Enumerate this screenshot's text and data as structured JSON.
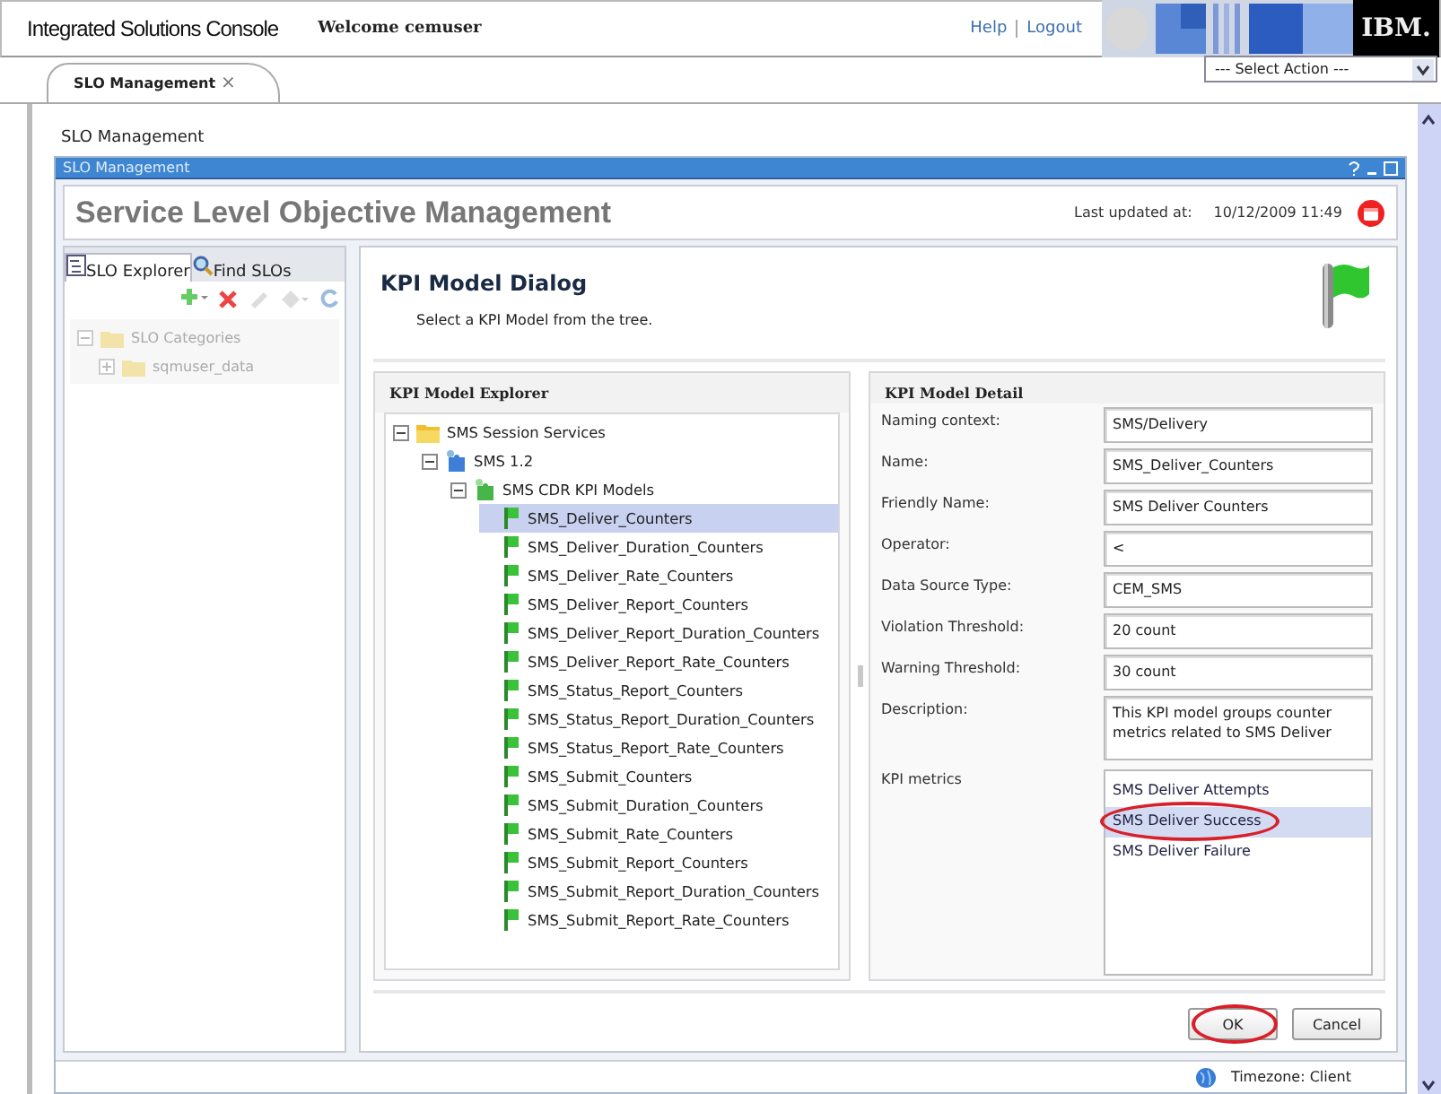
{
  "header": {
    "title": "Integrated Solutions Console",
    "welcome": "Welcome cemuser",
    "links": [
      "Help",
      "Logout"
    ],
    "logo": "IBM."
  },
  "tabs": [
    {
      "label": "SLO Management",
      "close": "×",
      "selected": true
    }
  ],
  "action_select": {
    "value": "--- Select Action ---"
  },
  "breadcrumb": "SLO Management",
  "portlet": {
    "title": "SLO Management"
  },
  "page": {
    "title": "Service Level Objective Management",
    "updated_label": "Last updated at:",
    "updated_value": "10/12/2009 11:49"
  },
  "slo_explorer": {
    "tabs": [
      {
        "label": "SLO Explorer",
        "selected": true
      },
      {
        "label": "Find SLOs",
        "selected": false
      }
    ],
    "disabled": true,
    "tree": [
      {
        "label": "SLO Categories",
        "expanded": true,
        "children": [
          {
            "label": "sqmuser_data",
            "expanded": false
          }
        ]
      }
    ]
  },
  "dialog": {
    "title": "KPI Model Dialog",
    "subtitle": "Select a KPI Model from the tree.",
    "explorer_title": "KPI Model Explorer",
    "tree": [
      {
        "label": "SMS Session Services",
        "kind": "folder",
        "expanded": true,
        "selected": false,
        "children": [
          {
            "label": "SMS 1.2",
            "kind": "service",
            "expanded": true,
            "selected": false,
            "children": [
              {
                "label": "SMS CDR KPI Models",
                "kind": "models",
                "expanded": true,
                "selected": false,
                "children": [
                  {
                    "label": "SMS_Deliver_Counters",
                    "kind": "model",
                    "selected": true
                  },
                  {
                    "label": "SMS_Deliver_Duration_Counters",
                    "kind": "model",
                    "selected": false
                  },
                  {
                    "label": "SMS_Deliver_Rate_Counters",
                    "kind": "model",
                    "selected": false
                  },
                  {
                    "label": "SMS_Deliver_Report_Counters",
                    "kind": "model",
                    "selected": false
                  },
                  {
                    "label": "SMS_Deliver_Report_Duration_Counters",
                    "kind": "model",
                    "selected": false
                  },
                  {
                    "label": "SMS_Deliver_Report_Rate_Counters",
                    "kind": "model",
                    "selected": false
                  },
                  {
                    "label": "SMS_Status_Report_Counters",
                    "kind": "model",
                    "selected": false
                  },
                  {
                    "label": "SMS_Status_Report_Duration_Counters",
                    "kind": "model",
                    "selected": false
                  },
                  {
                    "label": "SMS_Status_Report_Rate_Counters",
                    "kind": "model",
                    "selected": false
                  },
                  {
                    "label": "SMS_Submit_Counters",
                    "kind": "model",
                    "selected": false
                  },
                  {
                    "label": "SMS_Submit_Duration_Counters",
                    "kind": "model",
                    "selected": false
                  },
                  {
                    "label": "SMS_Submit_Rate_Counters",
                    "kind": "model",
                    "selected": false
                  },
                  {
                    "label": "SMS_Submit_Report_Counters",
                    "kind": "model",
                    "selected": false
                  },
                  {
                    "label": "SMS_Submit_Report_Duration_Counters",
                    "kind": "model",
                    "selected": false
                  },
                  {
                    "label": "SMS_Submit_Report_Rate_Counters",
                    "kind": "model",
                    "selected": false
                  }
                ]
              }
            ]
          }
        ]
      }
    ],
    "detail_title": "KPI Model Detail",
    "fields": [
      {
        "label": "Naming context:",
        "value": "SMS/Delivery",
        "kind": "input"
      },
      {
        "label": "Name:",
        "value": "SMS_Deliver_Counters",
        "kind": "input"
      },
      {
        "label": "Friendly Name:",
        "value": "SMS Deliver Counters",
        "kind": "input"
      },
      {
        "label": "Operator:",
        "value": "<",
        "kind": "input"
      },
      {
        "label": "Data Source Type:",
        "value": "CEM_SMS",
        "kind": "input"
      },
      {
        "label": "Violation Threshold:",
        "value": "20 count",
        "kind": "input"
      },
      {
        "label": "Warning Threshold:",
        "value": "30 count",
        "kind": "input"
      },
      {
        "label": "Description:",
        "value": "This KPI model groups counter metrics related to SMS Deliver",
        "kind": "textarea"
      }
    ],
    "metrics_label": "KPI metrics",
    "metrics": [
      {
        "label": "SMS Deliver Attempts",
        "selected": false,
        "circled": false
      },
      {
        "label": "SMS Deliver Success",
        "selected": true,
        "circled": true
      },
      {
        "label": "SMS Deliver Failure",
        "selected": false,
        "circled": false
      }
    ],
    "buttons": [
      {
        "label": "OK",
        "circled": true
      },
      {
        "label": "Cancel",
        "circled": false
      }
    ]
  },
  "footer": {
    "timezone": "Timezone: Client"
  }
}
